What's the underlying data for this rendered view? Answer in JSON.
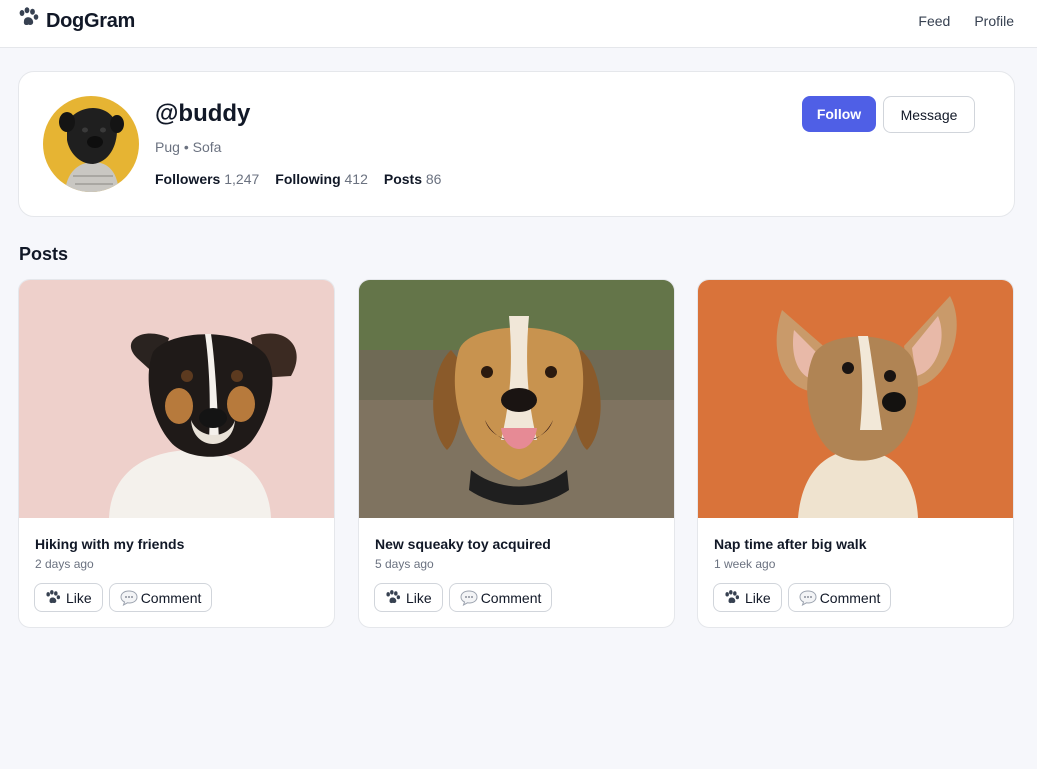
{
  "app": {
    "name": "DogGram",
    "logo_icon": "paw-icon"
  },
  "nav": {
    "items": [
      {
        "label": "Feed"
      },
      {
        "label": "Profile"
      }
    ]
  },
  "profile": {
    "username": "@buddy",
    "breed": "Pug",
    "location": "Sofa",
    "separator": "•",
    "stats": [
      {
        "label": "Followers",
        "value": "1,247"
      },
      {
        "label": "Following",
        "value": "412"
      },
      {
        "label": "Posts",
        "value": "86"
      }
    ],
    "follow_label": "Follow",
    "message_label": "Message",
    "colors": {
      "accent": "#4f5fe6",
      "avatar_bg": "#e6b433"
    }
  },
  "posts_section": {
    "title": "Posts"
  },
  "posts": [
    {
      "title": "Hiking with my friends",
      "time": "2 days ago",
      "like_label": "Like",
      "comment_label": "Comment",
      "photo_bg": "#ecc9c3"
    },
    {
      "title": "New squeaky toy acquired",
      "time": "5 days ago",
      "like_label": "Like",
      "comment_label": "Comment",
      "photo_bg": "#6f6a55"
    },
    {
      "title": "Nap time after big walk",
      "time": "1 week ago",
      "like_label": "Like",
      "comment_label": "Comment",
      "photo_bg": "#d9733a"
    }
  ]
}
